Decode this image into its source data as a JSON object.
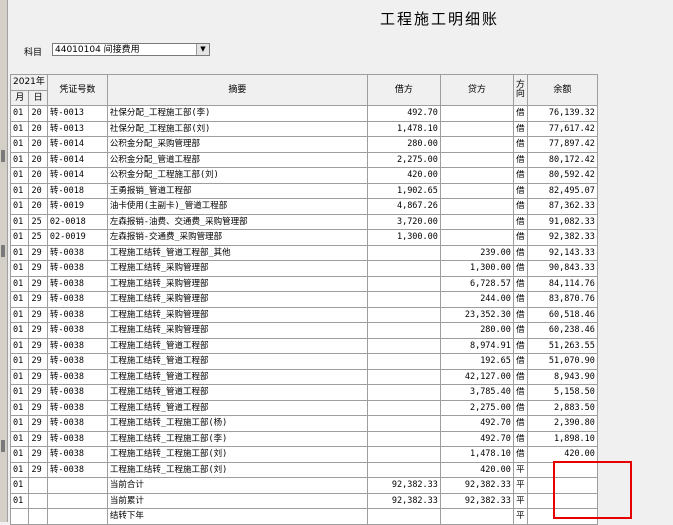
{
  "title": "工程施工明细账",
  "subject": {
    "label": "科目",
    "value": "44010104 间接费用"
  },
  "headers": {
    "year": "2021年",
    "month": "月",
    "day": "日",
    "voucher": "凭证号数",
    "summary": "摘要",
    "debit": "借方",
    "credit": "贷方",
    "direction": "方向",
    "balance": "余额"
  },
  "rows": [
    {
      "m": "01",
      "d": "20",
      "v": "转-0013",
      "s": "社保分配_工程施工部(李)",
      "dr": "492.70",
      "cr": "",
      "dir": "借",
      "bal": "76,139.32"
    },
    {
      "m": "01",
      "d": "20",
      "v": "转-0013",
      "s": "社保分配_工程施工部(刘)",
      "dr": "1,478.10",
      "cr": "",
      "dir": "借",
      "bal": "77,617.42"
    },
    {
      "m": "01",
      "d": "20",
      "v": "转-0014",
      "s": "公积金分配_采购管理部",
      "dr": "280.00",
      "cr": "",
      "dir": "借",
      "bal": "77,897.42"
    },
    {
      "m": "01",
      "d": "20",
      "v": "转-0014",
      "s": "公积金分配_管道工程部",
      "dr": "2,275.00",
      "cr": "",
      "dir": "借",
      "bal": "80,172.42"
    },
    {
      "m": "01",
      "d": "20",
      "v": "转-0014",
      "s": "公积金分配_工程施工部(刘)",
      "dr": "420.00",
      "cr": "",
      "dir": "借",
      "bal": "80,592.42"
    },
    {
      "m": "01",
      "d": "20",
      "v": "转-0018",
      "s": "王勇报销_管道工程部",
      "dr": "1,902.65",
      "cr": "",
      "dir": "借",
      "bal": "82,495.07"
    },
    {
      "m": "01",
      "d": "20",
      "v": "转-0019",
      "s": "油卡使用(主副卡)_管道工程部",
      "dr": "4,867.26",
      "cr": "",
      "dir": "借",
      "bal": "87,362.33"
    },
    {
      "m": "01",
      "d": "25",
      "v": "02-0018",
      "s": "左森报销-油费、交通费_采购管理部",
      "dr": "3,720.00",
      "cr": "",
      "dir": "借",
      "bal": "91,082.33"
    },
    {
      "m": "01",
      "d": "25",
      "v": "02-0019",
      "s": "左森报销-交通费_采购管理部",
      "dr": "1,300.00",
      "cr": "",
      "dir": "借",
      "bal": "92,382.33"
    },
    {
      "m": "01",
      "d": "29",
      "v": "转-0038",
      "s": "工程施工结转_管道工程部_其他",
      "dr": "",
      "cr": "239.00",
      "dir": "借",
      "bal": "92,143.33"
    },
    {
      "m": "01",
      "d": "29",
      "v": "转-0038",
      "s": "工程施工结转_采购管理部",
      "dr": "",
      "cr": "1,300.00",
      "dir": "借",
      "bal": "90,843.33"
    },
    {
      "m": "01",
      "d": "29",
      "v": "转-0038",
      "s": "工程施工结转_采购管理部",
      "dr": "",
      "cr": "6,728.57",
      "dir": "借",
      "bal": "84,114.76"
    },
    {
      "m": "01",
      "d": "29",
      "v": "转-0038",
      "s": "工程施工结转_采购管理部",
      "dr": "",
      "cr": "244.00",
      "dir": "借",
      "bal": "83,870.76"
    },
    {
      "m": "01",
      "d": "29",
      "v": "转-0038",
      "s": "工程施工结转_采购管理部",
      "dr": "",
      "cr": "23,352.30",
      "dir": "借",
      "bal": "60,518.46"
    },
    {
      "m": "01",
      "d": "29",
      "v": "转-0038",
      "s": "工程施工结转_采购管理部",
      "dr": "",
      "cr": "280.00",
      "dir": "借",
      "bal": "60,238.46"
    },
    {
      "m": "01",
      "d": "29",
      "v": "转-0038",
      "s": "工程施工结转_管道工程部",
      "dr": "",
      "cr": "8,974.91",
      "dir": "借",
      "bal": "51,263.55"
    },
    {
      "m": "01",
      "d": "29",
      "v": "转-0038",
      "s": "工程施工结转_管道工程部",
      "dr": "",
      "cr": "192.65",
      "dir": "借",
      "bal": "51,070.90"
    },
    {
      "m": "01",
      "d": "29",
      "v": "转-0038",
      "s": "工程施工结转_管道工程部",
      "dr": "",
      "cr": "42,127.00",
      "dir": "借",
      "bal": "8,943.90"
    },
    {
      "m": "01",
      "d": "29",
      "v": "转-0038",
      "s": "工程施工结转_管道工程部",
      "dr": "",
      "cr": "3,785.40",
      "dir": "借",
      "bal": "5,158.50"
    },
    {
      "m": "01",
      "d": "29",
      "v": "转-0038",
      "s": "工程施工结转_管道工程部",
      "dr": "",
      "cr": "2,275.00",
      "dir": "借",
      "bal": "2,883.50"
    },
    {
      "m": "01",
      "d": "29",
      "v": "转-0038",
      "s": "工程施工结转_工程施工部(杨)",
      "dr": "",
      "cr": "492.70",
      "dir": "借",
      "bal": "2,390.80"
    },
    {
      "m": "01",
      "d": "29",
      "v": "转-0038",
      "s": "工程施工结转_工程施工部(李)",
      "dr": "",
      "cr": "492.70",
      "dir": "借",
      "bal": "1,898.10"
    },
    {
      "m": "01",
      "d": "29",
      "v": "转-0038",
      "s": "工程施工结转_工程施工部(刘)",
      "dr": "",
      "cr": "1,478.10",
      "dir": "借",
      "bal": "420.00"
    },
    {
      "m": "01",
      "d": "29",
      "v": "转-0038",
      "s": "工程施工结转_工程施工部(刘)",
      "dr": "",
      "cr": "420.00",
      "dir": "平",
      "bal": ""
    },
    {
      "m": "01",
      "d": "",
      "v": "",
      "s": "当前合计",
      "dr": "92,382.33",
      "cr": "92,382.33",
      "dir": "平",
      "bal": ""
    },
    {
      "m": "01",
      "d": "",
      "v": "",
      "s": "当前累计",
      "dr": "92,382.33",
      "cr": "92,382.33",
      "dir": "平",
      "bal": ""
    },
    {
      "m": "",
      "d": "",
      "v": "",
      "s": "结转下年",
      "dr": "",
      "cr": "",
      "dir": "平",
      "bal": ""
    }
  ]
}
